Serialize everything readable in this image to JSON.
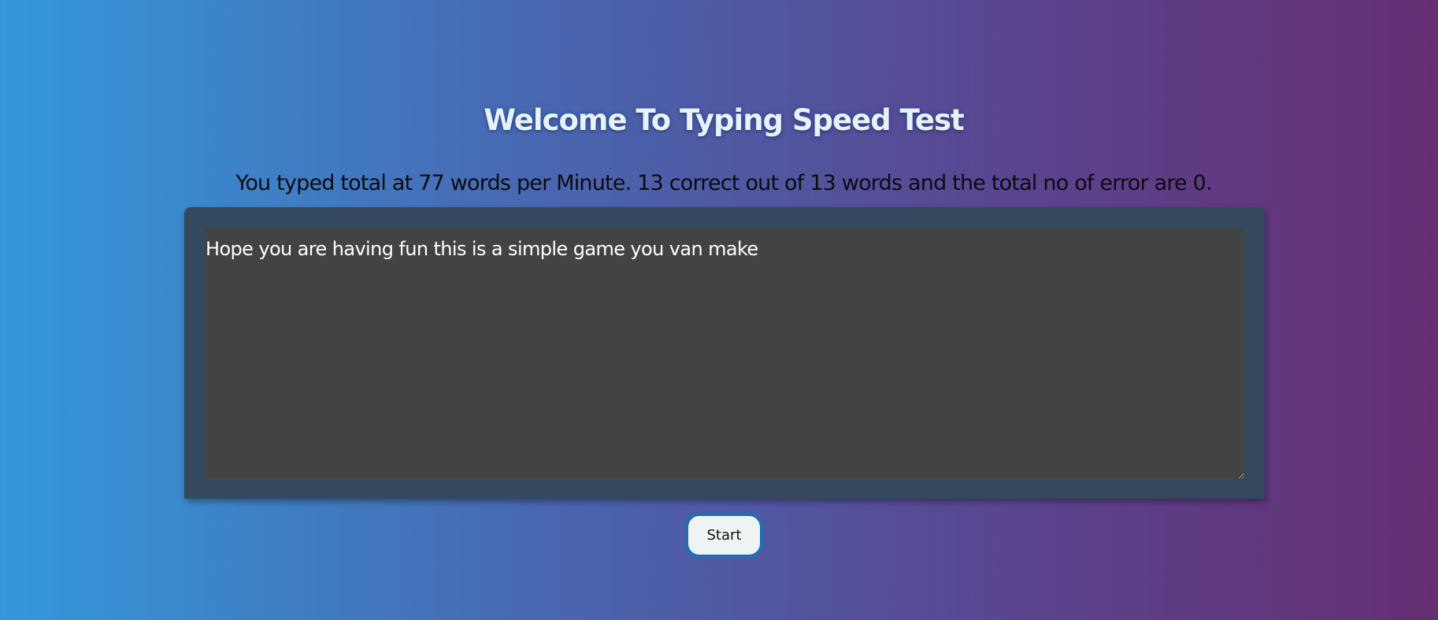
{
  "header": {
    "title": "Welcome To Typing Speed Test"
  },
  "result": {
    "message": "You typed total at 77 words per Minute. 13 correct out of 13 words and the total no of error are 0."
  },
  "editor": {
    "value": "Hope you are having fun this is a simple game you van make"
  },
  "controls": {
    "start_label": "Start"
  },
  "colors": {
    "gradient_start": "#3498db",
    "gradient_end": "#652e72",
    "panel": "#34495e",
    "textarea_bg": "#434343",
    "button_border": "#1f6fb0"
  }
}
